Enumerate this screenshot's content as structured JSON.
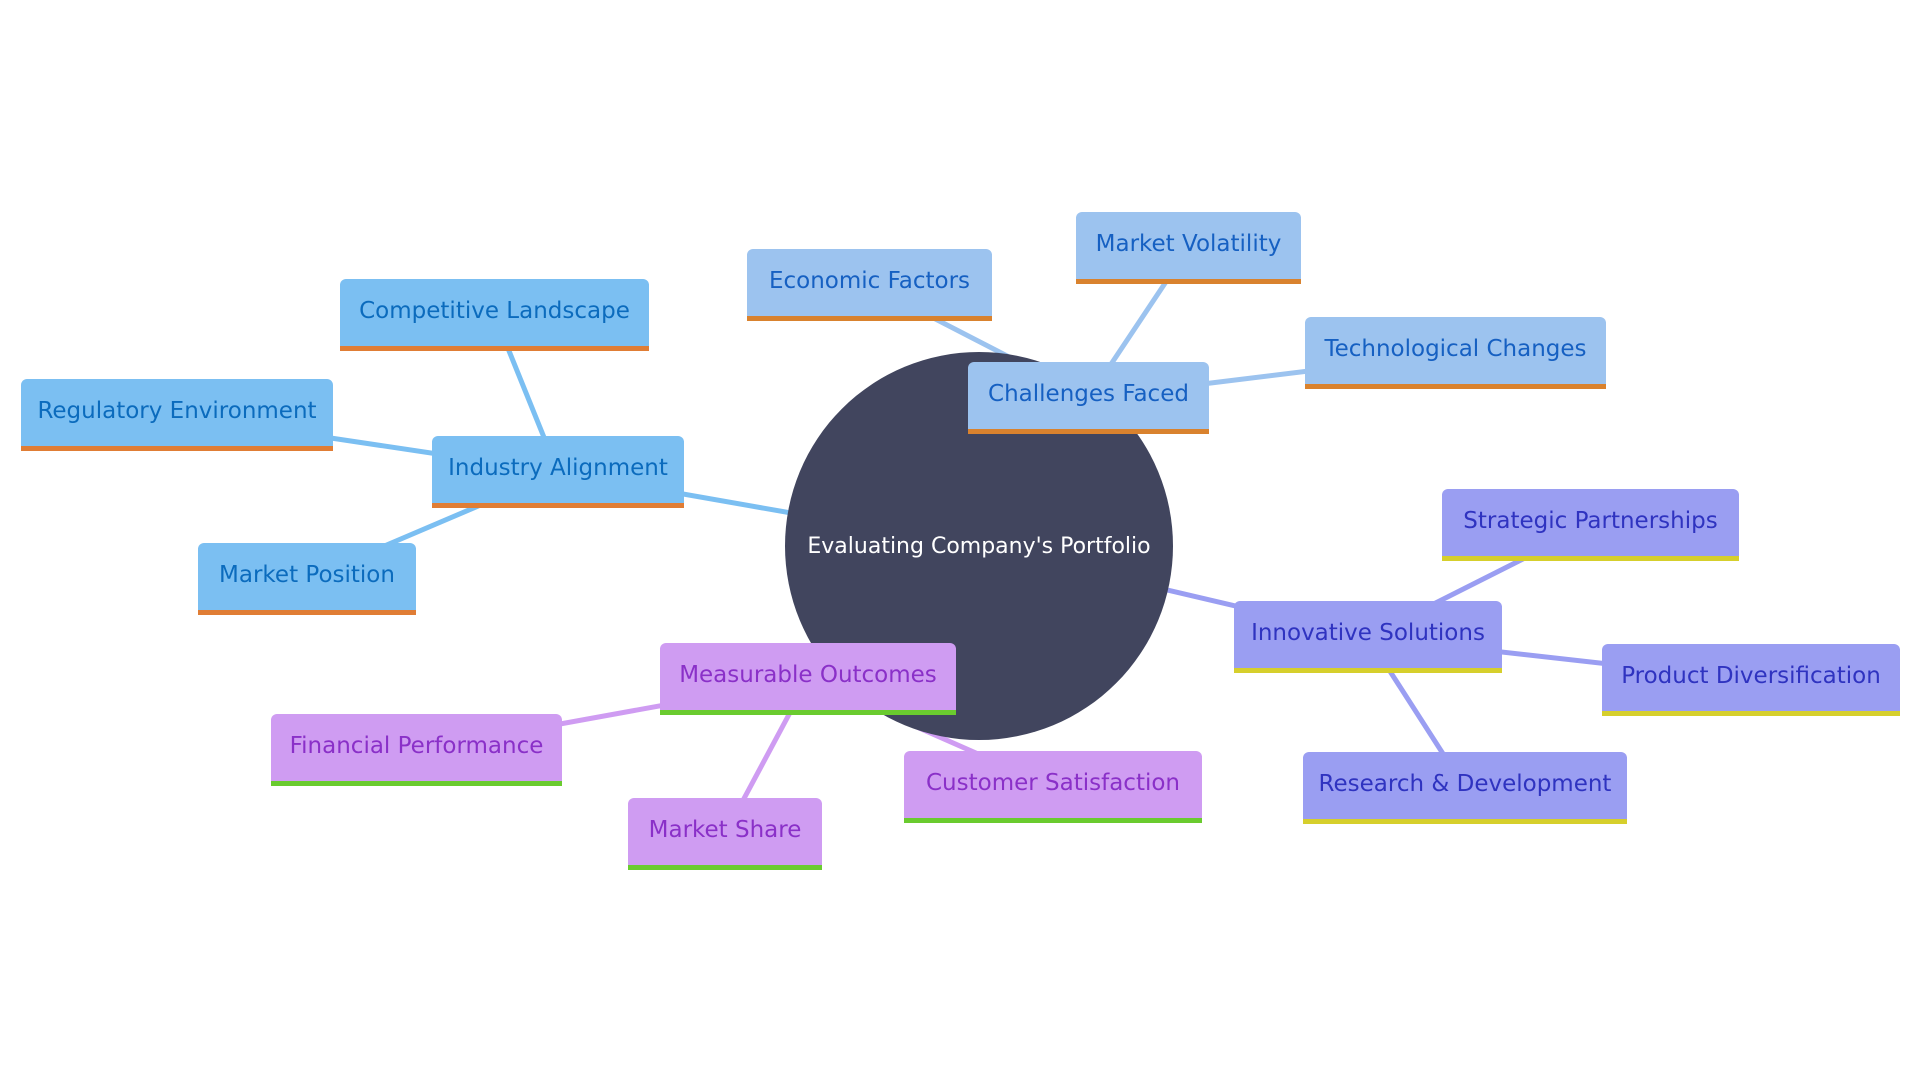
{
  "root": {
    "label": "Evaluating Company's Portfolio",
    "color": "#41455e"
  },
  "branches": [
    {
      "id": "industry",
      "label": "Industry Alignment",
      "colors": {
        "fill": "#7bbff2",
        "text": "#0b6bbd",
        "underline": "#e07d35",
        "edge": "#7bbff2"
      },
      "children": [
        "Competitive Landscape",
        "Regulatory Environment",
        "Market Position"
      ]
    },
    {
      "id": "challenges",
      "label": "Challenges Faced",
      "colors": {
        "fill": "#9cc3ef",
        "text": "#1660c2",
        "underline": "#d9822e",
        "edge": "#9cc3ef"
      },
      "children": [
        "Economic Factors",
        "Market Volatility",
        "Technological Changes"
      ]
    },
    {
      "id": "innovative",
      "label": "Innovative Solutions",
      "colors": {
        "fill": "#9a9ef2",
        "text": "#2f33c0",
        "underline": "#d6cf2c",
        "edge": "#9a9ef2"
      },
      "children": [
        "Strategic Partnerships",
        "Product Diversification",
        "Research & Development"
      ]
    },
    {
      "id": "measurable",
      "label": "Measurable Outcomes",
      "colors": {
        "fill": "#cf9cf2",
        "text": "#8a30c8",
        "underline": "#6acb2f",
        "edge": "#cf9cf2"
      },
      "children": [
        "Financial Performance",
        "Market Share",
        "Customer Satisfaction"
      ]
    }
  ]
}
